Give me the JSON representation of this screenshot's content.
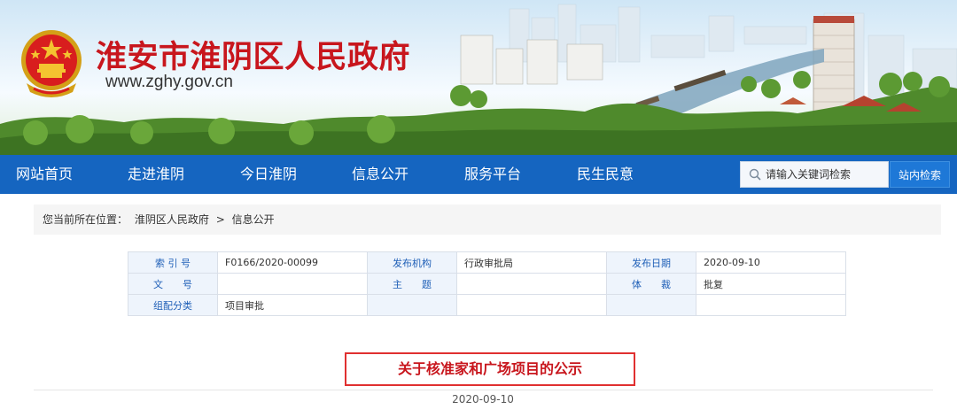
{
  "site": {
    "title": "淮安市淮阴区人民政府",
    "url": "www.zghy.gov.cn"
  },
  "nav": {
    "items": [
      "网站首页",
      "走进淮阴",
      "今日淮阴",
      "信息公开",
      "服务平台",
      "民生民意"
    ],
    "search_placeholder": "请输入关键词检索",
    "search_button": "站内检索"
  },
  "breadcrumb": {
    "prefix": "您当前所在位置：",
    "items": [
      "淮阴区人民政府",
      "信息公开"
    ],
    "separator": ">"
  },
  "meta": {
    "rows": [
      [
        {
          "label": "索 引 号",
          "value": "F0166/2020-00099"
        },
        {
          "label": "发布机构",
          "value": "行政审批局"
        },
        {
          "label": "发布日期",
          "value": "2020-09-10"
        }
      ],
      [
        {
          "label": "文　　号",
          "value": ""
        },
        {
          "label": "主　　题",
          "value": ""
        },
        {
          "label": "体　　裁",
          "value": "批复"
        }
      ],
      [
        {
          "label": "组配分类",
          "value": "项目审批"
        },
        {
          "label": "",
          "value": ""
        },
        {
          "label": "",
          "value": ""
        }
      ]
    ]
  },
  "article": {
    "title": "关于核准家和广场项目的公示",
    "date": "2020-09-10"
  },
  "colors": {
    "nav_bg": "#1565c0",
    "title_red": "#c8161d",
    "label_blue": "#1f5fb7"
  }
}
